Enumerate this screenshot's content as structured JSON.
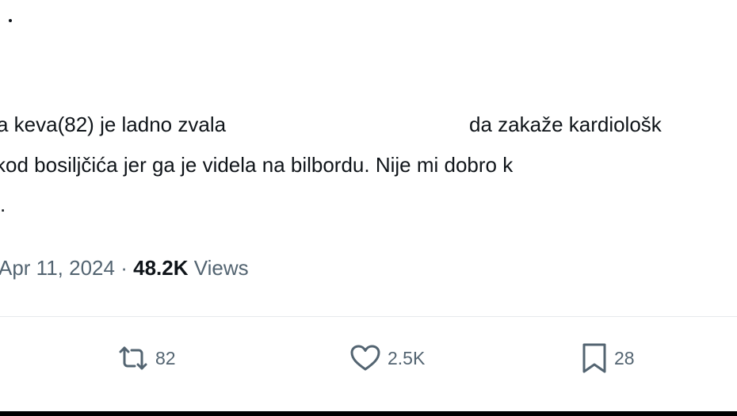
{
  "tweet": {
    "text_line1_part1": "a keva(82) je ladno zvala",
    "text_line1_part2": "da zakaže kardiološk",
    "text_line2": "kod bosiljčića jer ga je videla na bilbordu. Nije mi dobro k",
    "text_line3": ".",
    "date": "Apr 11, 2024",
    "separator": "·",
    "views_count": "48.2K",
    "views_label": "Views"
  },
  "actions": {
    "retweet_count": "82",
    "like_count": "2.5K",
    "bookmark_count": "28"
  },
  "icons": {
    "retweet": "retweet-icon",
    "like": "heart-icon",
    "bookmark": "bookmark-icon"
  },
  "colors": {
    "text": "#0f1419",
    "secondary": "#536471",
    "divider": "#e6e9ec"
  }
}
